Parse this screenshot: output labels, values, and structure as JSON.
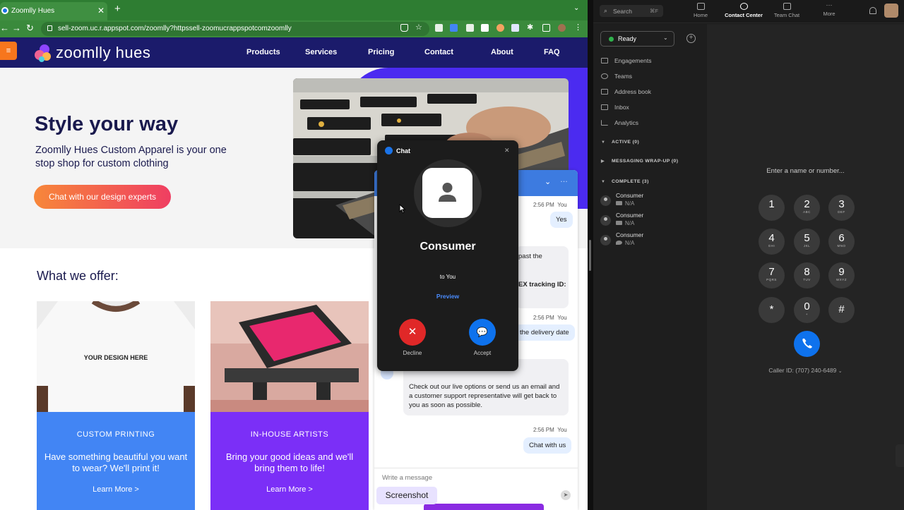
{
  "browser": {
    "tab_title": "Zoomlly Hues",
    "tab_close": "✕",
    "new_tab": "+",
    "url": "sell-zoom.uc.r.appspot.com/zoomlly?httpssell-zoomucrappspotcomzoomlly",
    "back": "←",
    "forward": "→",
    "reload": "↻"
  },
  "site": {
    "menu_icon": "≡",
    "logo_text": "zoomlly hues",
    "nav": [
      "Products",
      "Services",
      "Pricing",
      "Contact",
      "About",
      "FAQ"
    ],
    "hero": {
      "title": "Style your way",
      "subtitle": "Zoomlly Hues Custom Apparel is your one stop shop for custom clothing",
      "cta": "Chat with our design experts"
    },
    "offer_title": "What we offer:",
    "cards": [
      {
        "shirt_text": "YOUR DESIGN HERE",
        "title": "CUSTOM PRINTING",
        "desc": "Have something beautiful you want to wear? We'll print it!",
        "link": "Learn More >",
        "color": "#4285f4"
      },
      {
        "title": "IN-HOUSE ARTISTS",
        "desc": "Bring your good ideas and we'll bring them to life!",
        "link": "Learn More >",
        "color": "#7b2ff7"
      }
    ]
  },
  "chat_widget": {
    "messages": [
      {
        "time": "2:56 PM",
        "who": "You",
        "text": "Yes"
      },
      {
        "fragment1": "past the",
        "fragment2": "EX tracking ID:"
      },
      {
        "time": "2:56 PM",
        "who": "You",
        "text": "the delivery date"
      },
      {
        "text": "Check out our live options or send us an email and a customer support representative will get back to you as soon as possible."
      },
      {
        "time": "2:56 PM",
        "who": "You",
        "text": "Chat with us"
      }
    ],
    "input_placeholder": "Write a message",
    "screenshot_chip": "Screenshot"
  },
  "incoming_chat": {
    "header": "Chat",
    "close": "✕",
    "caller": "Consumer",
    "to": "to You",
    "preview": "Preview",
    "decline": "Decline",
    "accept": "Accept",
    "decline_icon": "✕",
    "accept_icon": "💬"
  },
  "zoom": {
    "search": "Search",
    "search_shortcut": "⌘F",
    "tabs": [
      "Home",
      "Contact Center",
      "Team Chat",
      "More"
    ],
    "status": "Ready",
    "status_color": "#2fb24c",
    "nav": [
      "Engagements",
      "Teams",
      "Address book",
      "Inbox",
      "Analytics"
    ],
    "sections": [
      "ACTIVE (0)",
      "MESSAGING WRAP-UP (0)",
      "COMPLETE (3)"
    ],
    "completed": [
      {
        "name": "Consumer",
        "status": "N/A"
      },
      {
        "name": "Consumer",
        "status": "N/A"
      },
      {
        "name": "Consumer",
        "status": "N/A"
      }
    ],
    "dial_prompt": "Enter a name or number...",
    "keys": [
      {
        "d": "1",
        "l": ""
      },
      {
        "d": "2",
        "l": "ABC"
      },
      {
        "d": "3",
        "l": "DEF"
      },
      {
        "d": "4",
        "l": "GHI"
      },
      {
        "d": "5",
        "l": "JKL"
      },
      {
        "d": "6",
        "l": "MNO"
      },
      {
        "d": "7",
        "l": "PQRS"
      },
      {
        "d": "8",
        "l": "TUV"
      },
      {
        "d": "9",
        "l": "WXYZ"
      },
      {
        "d": "*",
        "l": ""
      },
      {
        "d": "0",
        "l": "+"
      },
      {
        "d": "#",
        "l": ""
      }
    ],
    "caller_id": "Caller ID: (707) 240-6489",
    "accent": "#0e72ed"
  }
}
